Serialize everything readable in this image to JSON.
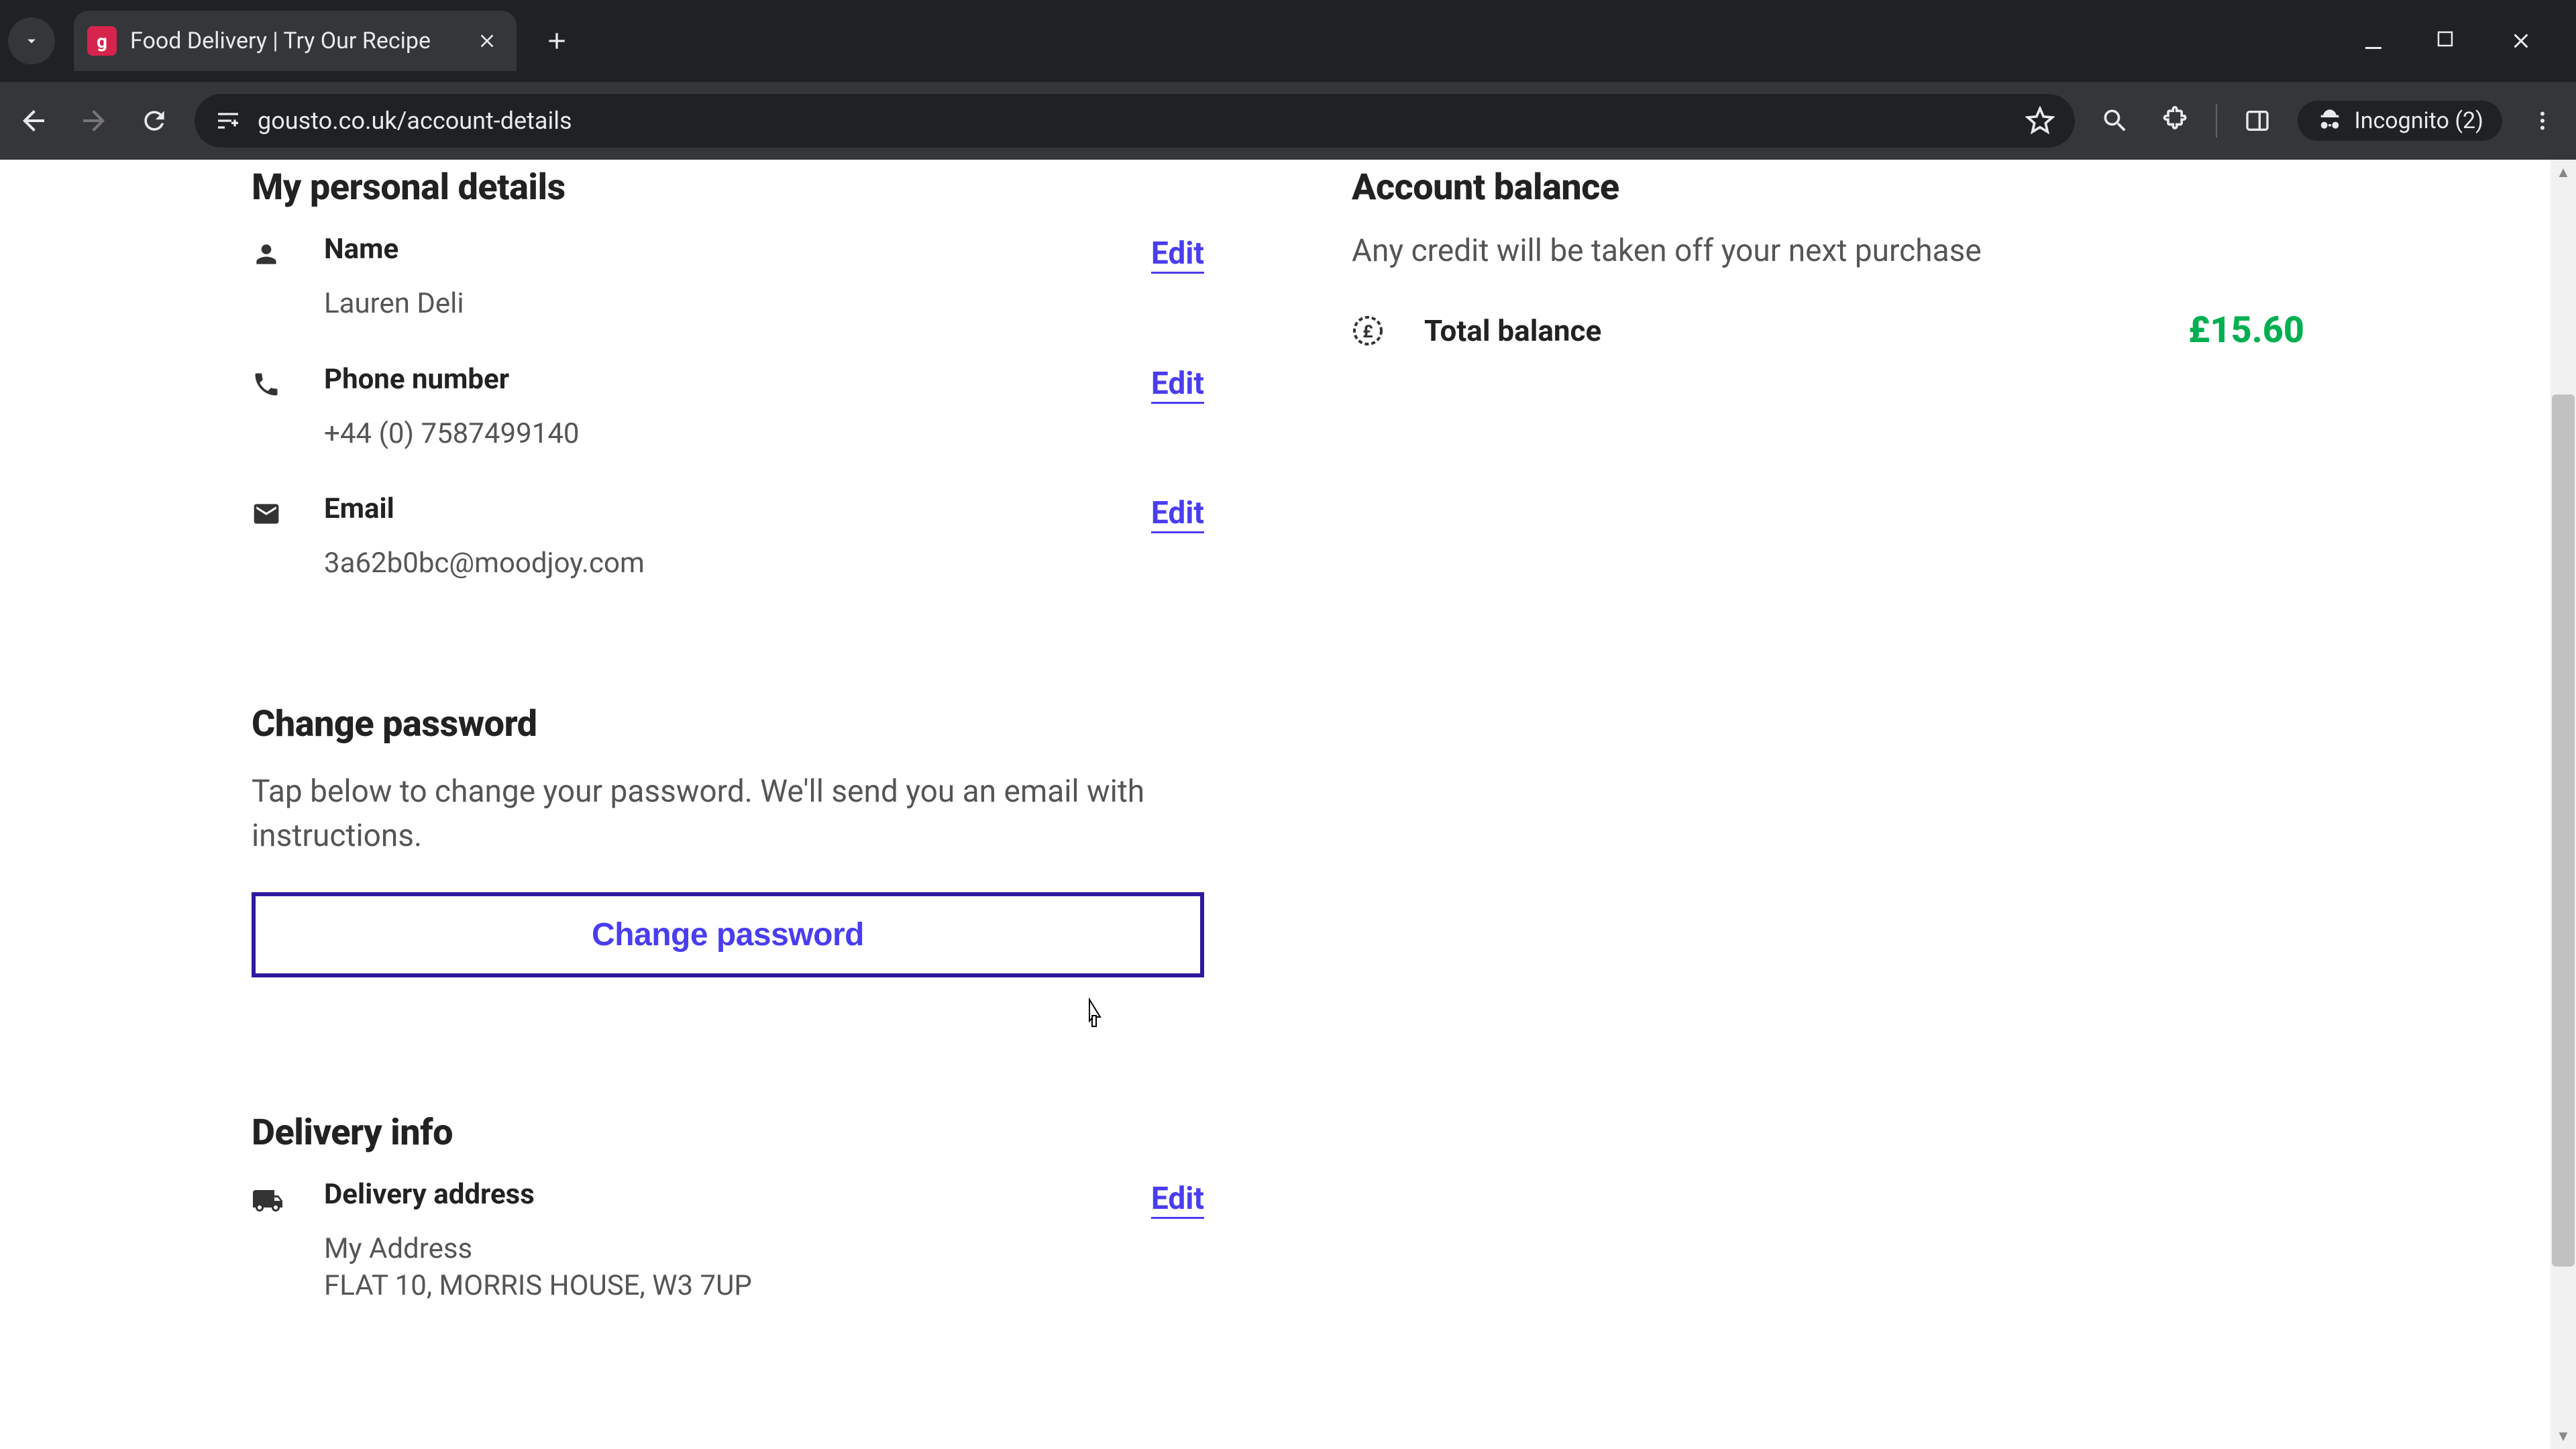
{
  "browser": {
    "tab_title": "Food Delivery | Try Our Recipe",
    "url_display": "gousto.co.uk/account-details",
    "incognito_label": "Incognito (2)"
  },
  "personal": {
    "title": "My personal details",
    "name_label": "Name",
    "name_value": "Lauren Deli",
    "phone_label": "Phone number",
    "phone_value": "+44 (0) 7587499140",
    "email_label": "Email",
    "email_value": "3a62b0bc@moodjoy.com",
    "edit_label": "Edit"
  },
  "password": {
    "title": "Change password",
    "desc": "Tap below to change your password. We'll send you an email with instructions.",
    "button_label": "Change password"
  },
  "delivery": {
    "title": "Delivery info",
    "address_label": "Delivery address",
    "address_value": "My Address\nFLAT 10, MORRIS HOUSE, W3 7UP",
    "edit_label": "Edit"
  },
  "balance": {
    "title": "Account balance",
    "desc": "Any credit will be taken off your next purchase",
    "total_label": "Total balance",
    "amount": "£15.60"
  }
}
